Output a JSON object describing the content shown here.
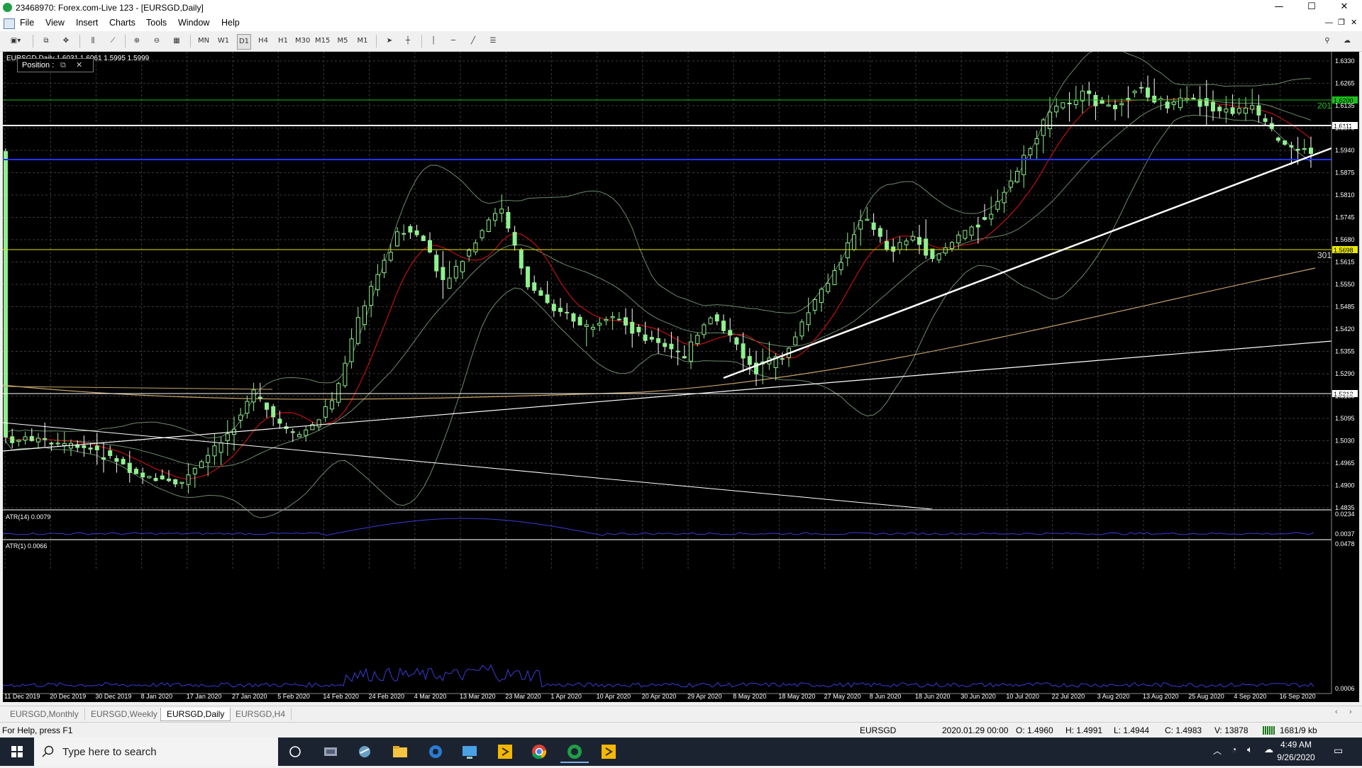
{
  "window": {
    "title": "23468970: Forex.com-Live 123 - [EURSGD,Daily]",
    "controls": [
      "—",
      "☐",
      "✕"
    ]
  },
  "menu": [
    "File",
    "View",
    "Insert",
    "Charts",
    "Tools",
    "Window",
    "Help"
  ],
  "toolbar": {
    "timeframes": [
      "MN",
      "W1",
      "D1",
      "H4",
      "H1",
      "M30",
      "M15",
      "M5",
      "M1"
    ],
    "active_timeframe": "D1"
  },
  "chart": {
    "info_label": "EURSGD,Daily  1.6031 1.6061 1.5995 1.5999",
    "position_panel": "Position :",
    "price_ticks": [
      "1.6330",
      "1.6265",
      "1.6135",
      "1.6070",
      "1.5940",
      "1.5875",
      "1.5810",
      "1.5745",
      "1.5680",
      "1.5615",
      "1.5550",
      "1.5485",
      "1.5420",
      "1.5355",
      "1.5290",
      "1.5160",
      "1.5095",
      "1.5030",
      "1.4965",
      "1.4900",
      "1.4835"
    ],
    "price_markers": [
      {
        "label": "1.6200",
        "bg": "#19c019",
        "fg": "#000000"
      },
      {
        "label": "1.6111",
        "bg": "#ffffff",
        "fg": "#000000"
      },
      {
        "label": "1.5698",
        "bg": "#e8e800",
        "fg": "#000000"
      },
      {
        "label": "1.5212",
        "bg": "#ffffff",
        "fg": "#000000"
      }
    ],
    "line_labels": [
      {
        "text": "201",
        "color": "#19c019"
      },
      {
        "text": "301",
        "color": "#dddddd"
      }
    ],
    "atr14": {
      "label": "ATR(14) 0.0079",
      "ticks": [
        "0.0234",
        "0.0037"
      ]
    },
    "atr1": {
      "label": "ATR(1) 0.0066",
      "ticks": [
        "0.0478",
        "0.0006"
      ]
    },
    "date_ticks": [
      "11 Dec 2019",
      "20 Dec 2019",
      "30 Dec 2019",
      "8 Jan 2020",
      "17 Jan 2020",
      "27 Jan 2020",
      "5 Feb 2020",
      "14 Feb 2020",
      "24 Feb 2020",
      "4 Mar 2020",
      "13 Mar 2020",
      "23 Mar 2020",
      "1 Apr 2020",
      "10 Apr 2020",
      "20 Apr 2020",
      "29 Apr 2020",
      "8 May 2020",
      "18 May 2020",
      "27 May 2020",
      "8 Jun 2020",
      "18 Jun 2020",
      "30 Jun 2020",
      "10 Jul 2020",
      "22 Jul 2020",
      "3 Aug 2020",
      "13 Aug 2020",
      "25 Aug 2020",
      "4 Sep 2020",
      "16 Sep 2020"
    ],
    "colors": {
      "grid": "#3a3a3a",
      "bull": "#8ff08f",
      "bear": "#ffffff",
      "bands": "#6b8a6b",
      "ma_fast": "#c01010",
      "ma_slow": "#c8a46a",
      "atr": "#3b3bd6"
    }
  },
  "chart_tabs": [
    {
      "label": "EURSGD,Monthly",
      "active": false
    },
    {
      "label": "EURSGD,Weekly",
      "active": false
    },
    {
      "label": "EURSGD,Daily",
      "active": true
    },
    {
      "label": "EURSGD,H4",
      "active": false
    }
  ],
  "status": {
    "help": "For Help, press F1",
    "symbol": "EURSGD",
    "datetime": "2020.01.29 00:00",
    "open": "O: 1.4960",
    "high": "H: 1.4991",
    "low": "L: 1.4944",
    "close": "C: 1.4983",
    "volume": "V: 13878",
    "traffic": "1681/9 kb"
  },
  "taskbar": {
    "search_placeholder": "Type here to search",
    "time": "4:49 AM",
    "date": "9/26/2020"
  }
}
